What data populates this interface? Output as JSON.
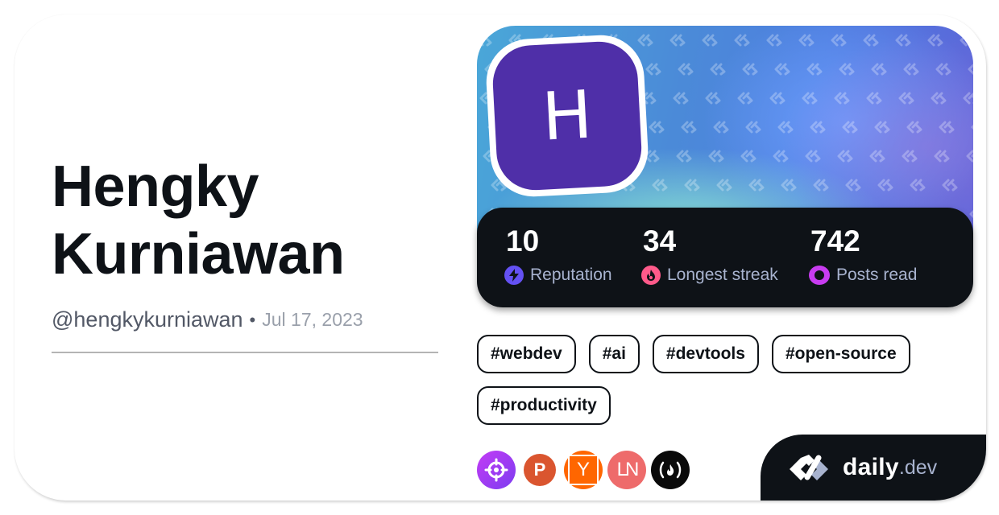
{
  "profile": {
    "name_line1": "Hengky",
    "name_line2": "Kurniawan",
    "handle": "@hengkykurniawan",
    "separator": "•",
    "joined": "Jul 17, 2023",
    "avatar_initial": "H",
    "avatar_color": "#4f2fa8"
  },
  "stats": [
    {
      "value": "10",
      "label": "Reputation",
      "icon": "lightning-icon",
      "color": "#6451f3"
    },
    {
      "value": "34",
      "label": "Longest streak",
      "icon": "flame-icon",
      "color": "#ff5a8a"
    },
    {
      "value": "742",
      "label": "Posts read",
      "icon": "ring-icon",
      "color": "#c83cf0"
    }
  ],
  "tags": [
    "#webdev",
    "#ai",
    "#devtools",
    "#open-source",
    "#productivity"
  ],
  "sources": [
    {
      "name": "crosshair-source-icon",
      "glyph": "⌖",
      "color": "#a13cf5"
    },
    {
      "name": "producthunt-source-icon",
      "glyph": "P",
      "color": "#da552f"
    },
    {
      "name": "hackernews-source-icon",
      "glyph": "Y",
      "color": "#ff6600"
    },
    {
      "name": "lobsters-source-icon",
      "glyph": "LN",
      "color": "#ee6b6b"
    },
    {
      "name": "freecodecamp-source-icon",
      "glyph": "(🔥)",
      "color": "#0a0a0a"
    }
  ],
  "brand": {
    "name": "daily",
    "tld": ".dev"
  }
}
